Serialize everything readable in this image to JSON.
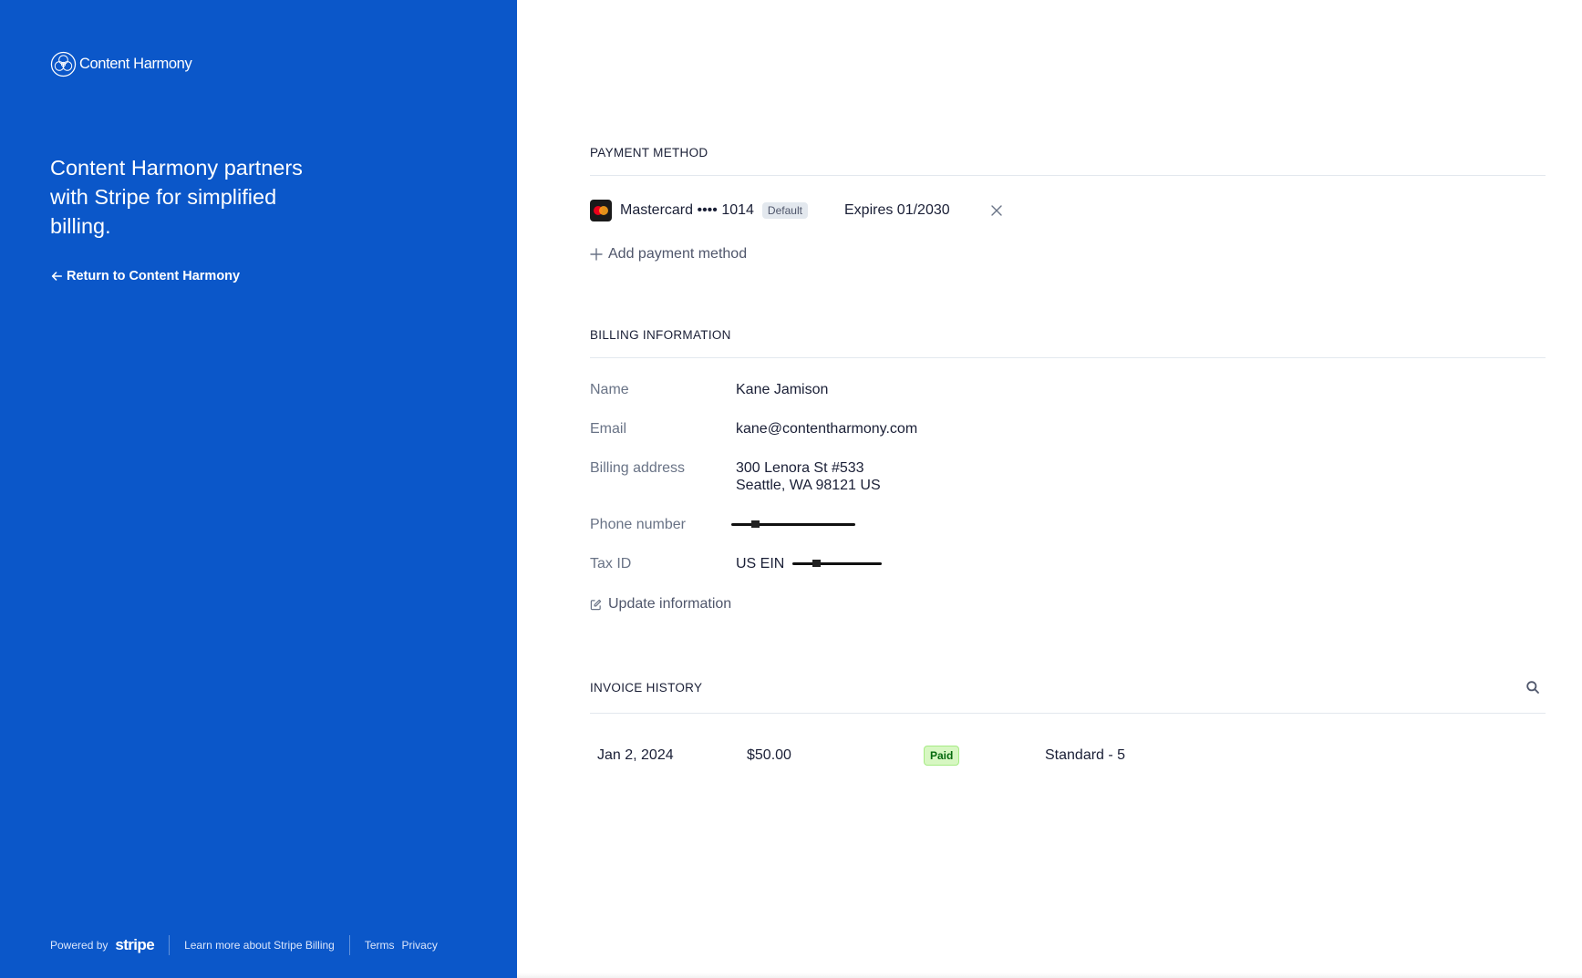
{
  "brand": {
    "name": "Content Harmony"
  },
  "left": {
    "headline": "Content Harmony partners with Stripe for simplified billing.",
    "return_link": "Return to Content Harmony"
  },
  "footer": {
    "powered_by": "Powered by",
    "stripe": "stripe",
    "learn_more": "Learn more about Stripe Billing",
    "terms": "Terms",
    "privacy": "Privacy"
  },
  "payment_method": {
    "title": "PAYMENT METHOD",
    "card_label": "Mastercard •••• 1014",
    "badge": "Default",
    "expires": "Expires 01/2030",
    "add_label": "Add payment method"
  },
  "billing": {
    "title": "BILLING INFORMATION",
    "rows": [
      {
        "label": "Name",
        "value": "Kane Jamison"
      },
      {
        "label": "Email",
        "value": "kane@contentharmony.com"
      },
      {
        "label": "Billing address",
        "value": "300 Lenora St #533",
        "value2": "Seattle, WA 98121 US"
      },
      {
        "label": "Phone number",
        "value": ""
      },
      {
        "label": "Tax ID",
        "value": "US EIN"
      }
    ],
    "update_label": "Update information"
  },
  "invoices": {
    "title": "INVOICE HISTORY",
    "rows": [
      {
        "date": "Jan 2, 2024",
        "amount": "$50.00",
        "status": "Paid",
        "plan": "Standard - 5"
      }
    ]
  },
  "colors": {
    "brand_blue": "#0b57c9",
    "paid_bg": "#d7f7c2",
    "paid_text": "#05690d"
  }
}
